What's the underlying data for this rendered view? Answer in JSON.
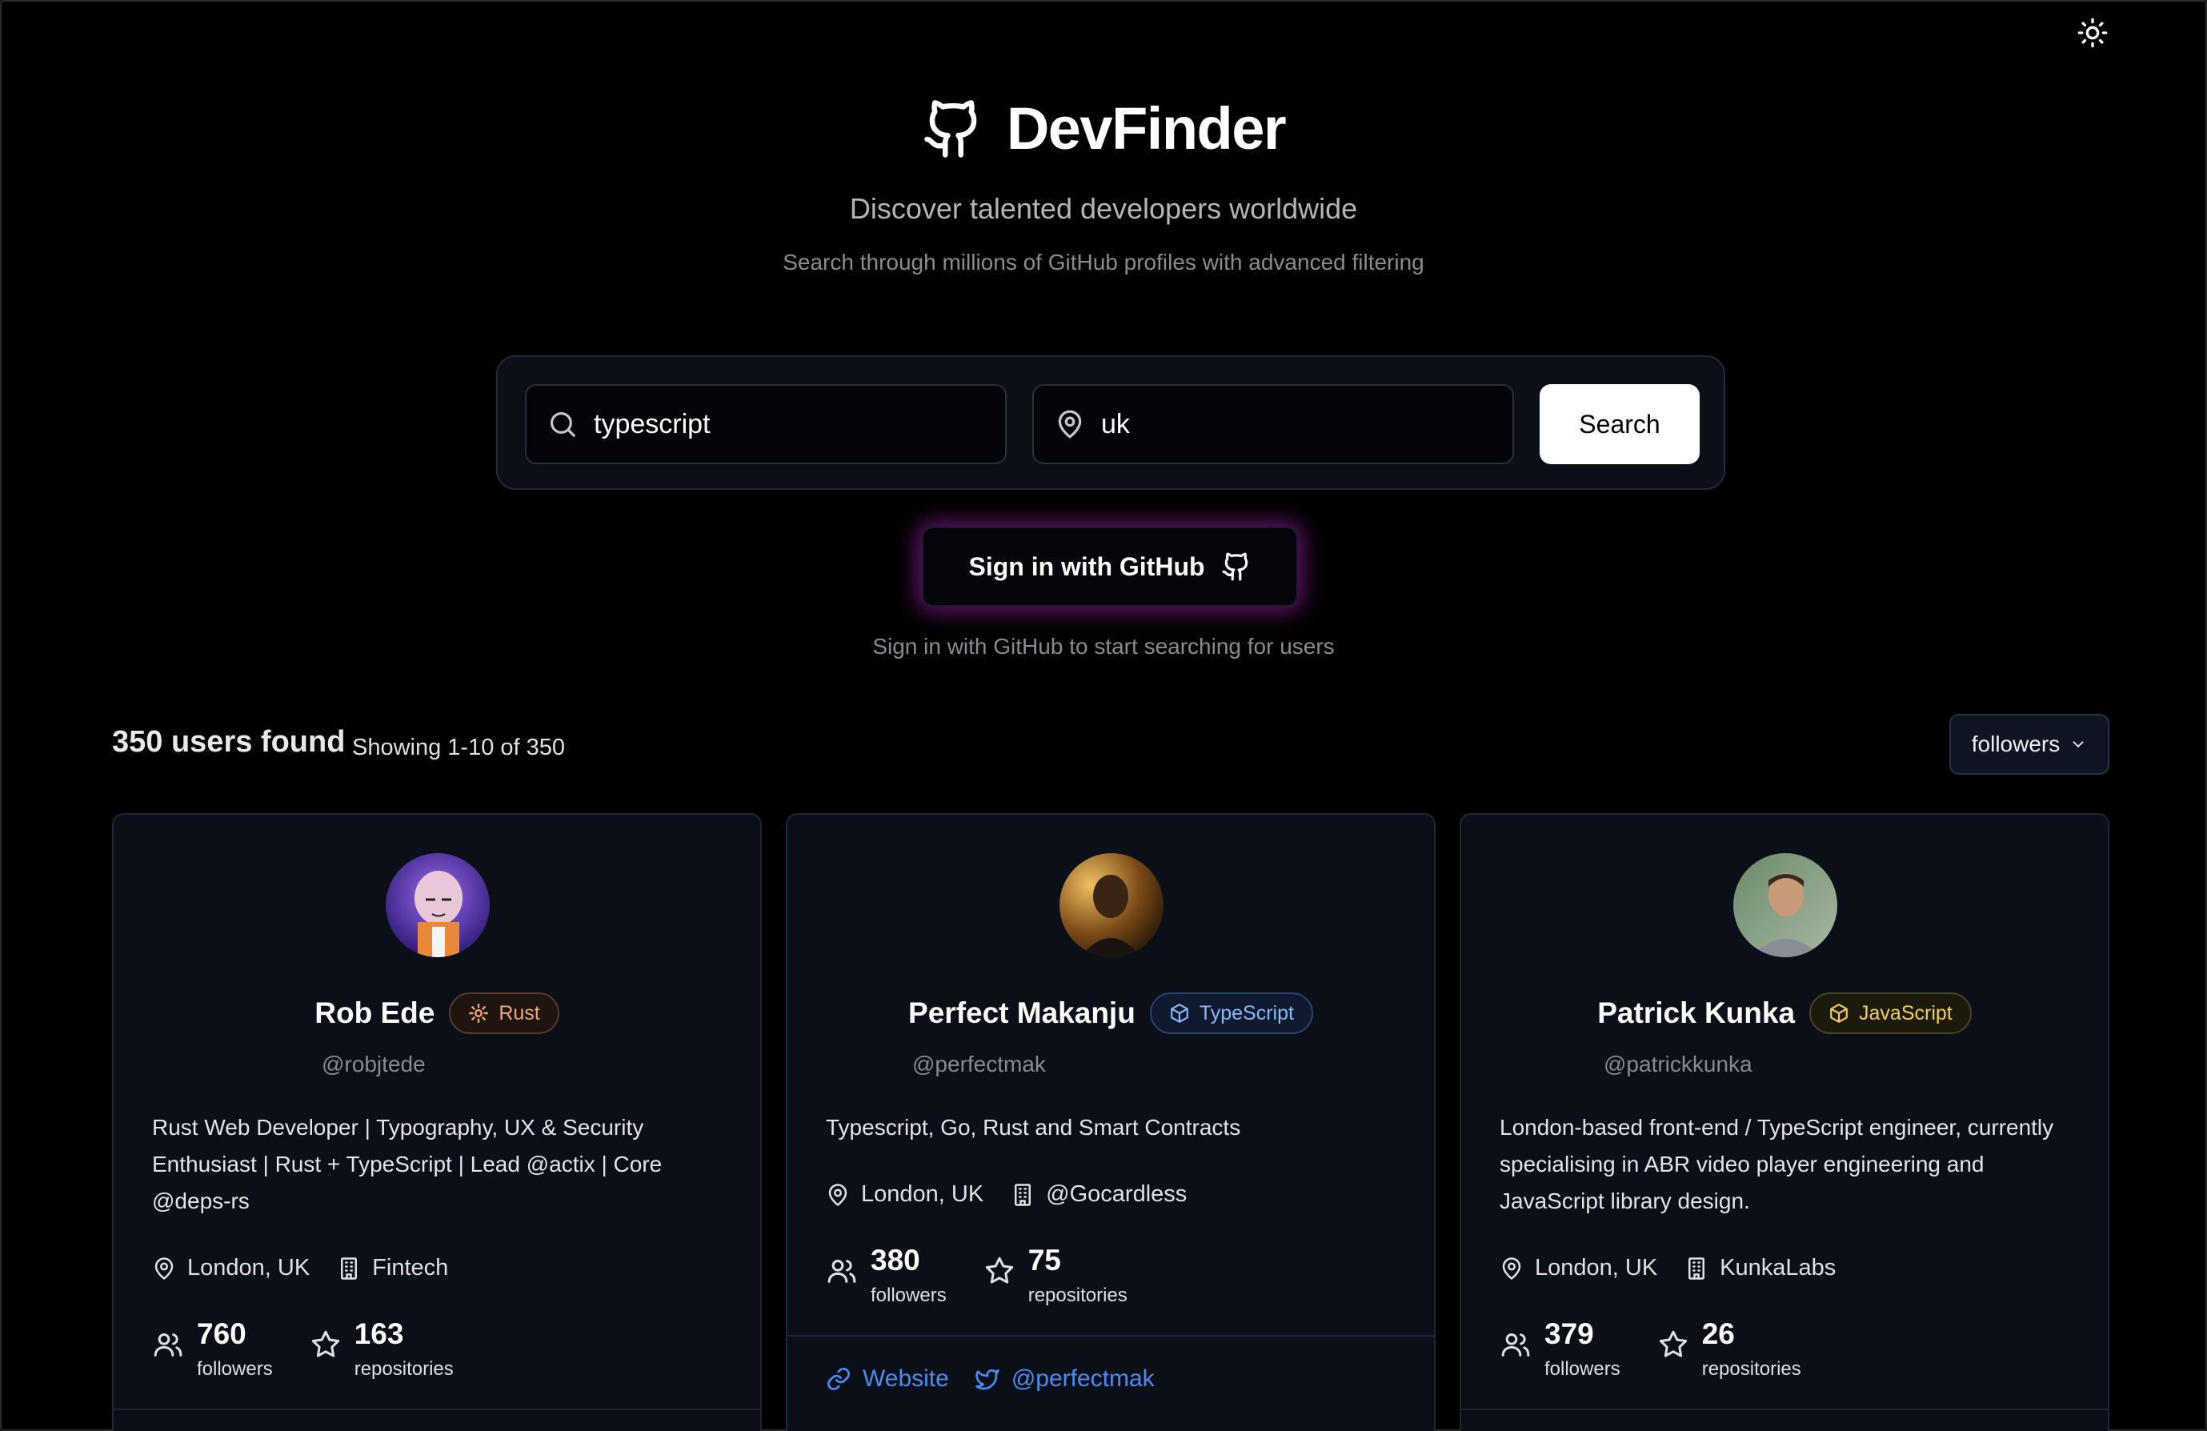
{
  "app": {
    "title": "DevFinder",
    "tagline": "Discover talented developers worldwide",
    "subtagline": "Search through millions of GitHub profiles with advanced filtering"
  },
  "search": {
    "query": "typescript",
    "location": "uk",
    "button_label": "Search"
  },
  "auth": {
    "button_label": "Sign in with GitHub",
    "hint": "Sign in with GitHub to start searching for users"
  },
  "results": {
    "count_text": "350 users found",
    "range_text": "Showing 1-10 of 350",
    "sort_value": "followers"
  },
  "colors": {
    "background": "#000000",
    "card": "#0b0f17",
    "link": "#4a8cf0",
    "signin_glow": "#ba28c8"
  },
  "users": [
    {
      "name": "Rob Ede",
      "handle": "@robjtede",
      "language": {
        "label": "Rust",
        "icon": "gear-icon",
        "color": "#f0a878",
        "bg": "#1f1410",
        "border": "#5a3a2a"
      },
      "bio": "Rust Web Developer | Typography, UX & Security Enthusiast | Rust + TypeScript | Lead @actix | Core @deps-rs",
      "location": "London, UK",
      "company": "Fintech",
      "followers": "760",
      "followers_label": "followers",
      "repos": "163",
      "repos_label": "repositories"
    },
    {
      "name": "Perfect Makanju",
      "handle": "@perfectmak",
      "language": {
        "label": "TypeScript",
        "icon": "cube-icon",
        "color": "#8ab8f8",
        "bg": "#0f1a2e",
        "border": "#2a4470"
      },
      "bio": "Typescript, Go, Rust and Smart Contracts",
      "location": "London, UK",
      "company": "@Gocardless",
      "followers": "380",
      "followers_label": "followers",
      "repos": "75",
      "repos_label": "repositories",
      "website_label": "Website",
      "twitter_label": "@perfectmak"
    },
    {
      "name": "Patrick Kunka",
      "handle": "@patrickkunka",
      "language": {
        "label": "JavaScript",
        "icon": "cube-icon",
        "color": "#f0d050",
        "bg": "#1c1a0c",
        "border": "#4a4420"
      },
      "bio": "London-based front-end / TypeScript engineer, currently specialising in ABR video player engineering and JavaScript library design.",
      "location": "London, UK",
      "company": "KunkaLabs",
      "followers": "379",
      "followers_label": "followers",
      "repos": "26",
      "repos_label": "repositories"
    }
  ]
}
